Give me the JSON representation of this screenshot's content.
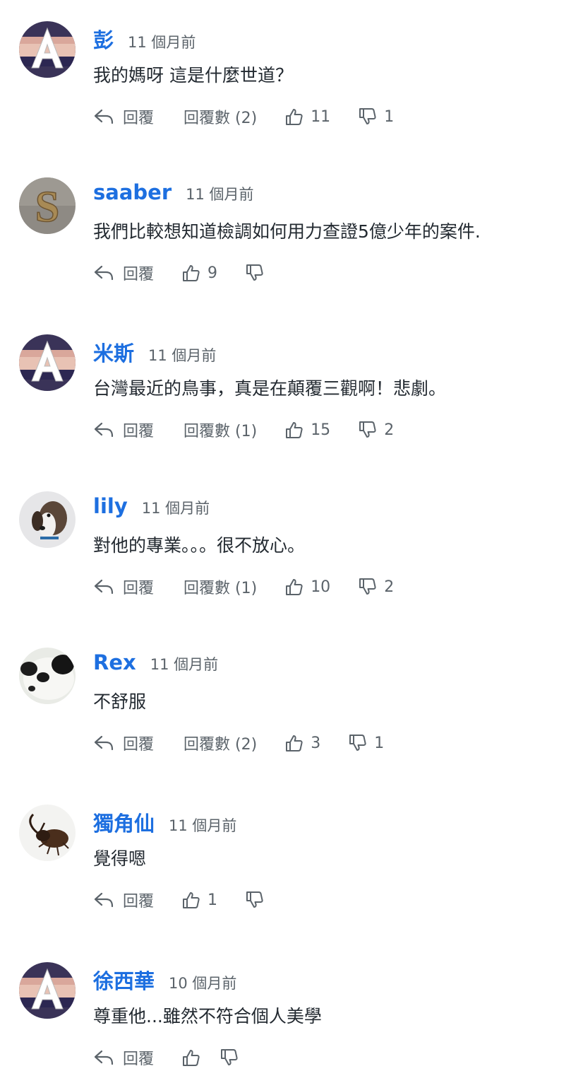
{
  "comments": [
    {
      "author": "彭",
      "time": "11 個月前",
      "text": "我的媽呀 這是什麼世道？",
      "reply_label": "回覆",
      "replies": "回覆數 (2)",
      "likes": "11",
      "dislikes": "1",
      "avatar_icon": "letter-a-avatar-icon"
    },
    {
      "author": "saaber",
      "time": "11 個月前",
      "text": "我們比較想知道檢調如何用力查證5億少年的案件.",
      "reply_label": "回覆",
      "replies": "",
      "likes": "9",
      "dislikes": "",
      "avatar_icon": "letter-s-avatar-icon"
    },
    {
      "author": "米斯",
      "time": "11 個月前",
      "text": "台灣最近的鳥事，真是在顛覆三觀啊！悲劇。",
      "reply_label": "回覆",
      "replies": "回覆數 (1)",
      "likes": "15",
      "dislikes": "2",
      "avatar_icon": "letter-a-avatar-icon"
    },
    {
      "author": "lily",
      "time": "11 個月前",
      "text": "對他的專業。。。很不放心。",
      "reply_label": "回覆",
      "replies": "回覆數 (1)",
      "likes": "10",
      "dislikes": "2",
      "avatar_icon": "dog-avatar-icon"
    },
    {
      "author": "Rex",
      "time": "11 個月前",
      "text": "不舒服",
      "reply_label": "回覆",
      "replies": "回覆數 (2)",
      "likes": "3",
      "dislikes": "1",
      "avatar_icon": "panda-avatar-icon"
    },
    {
      "author": "獨角仙",
      "time": "11 個月前",
      "text": "覺得嗯",
      "reply_label": "回覆",
      "replies": "",
      "likes": "1",
      "dislikes": "",
      "avatar_icon": "beetle-avatar-icon"
    },
    {
      "author": "徐西華",
      "time": "10 個月前",
      "text": "尊重他...雖然不符合個人美學",
      "reply_label": "回覆",
      "replies": "",
      "likes": "",
      "dislikes": "",
      "avatar_icon": "letter-a-avatar-icon"
    }
  ],
  "colors": {
    "author": "#1d6fe0",
    "text": "#232a31",
    "meta": "#5b636a"
  }
}
